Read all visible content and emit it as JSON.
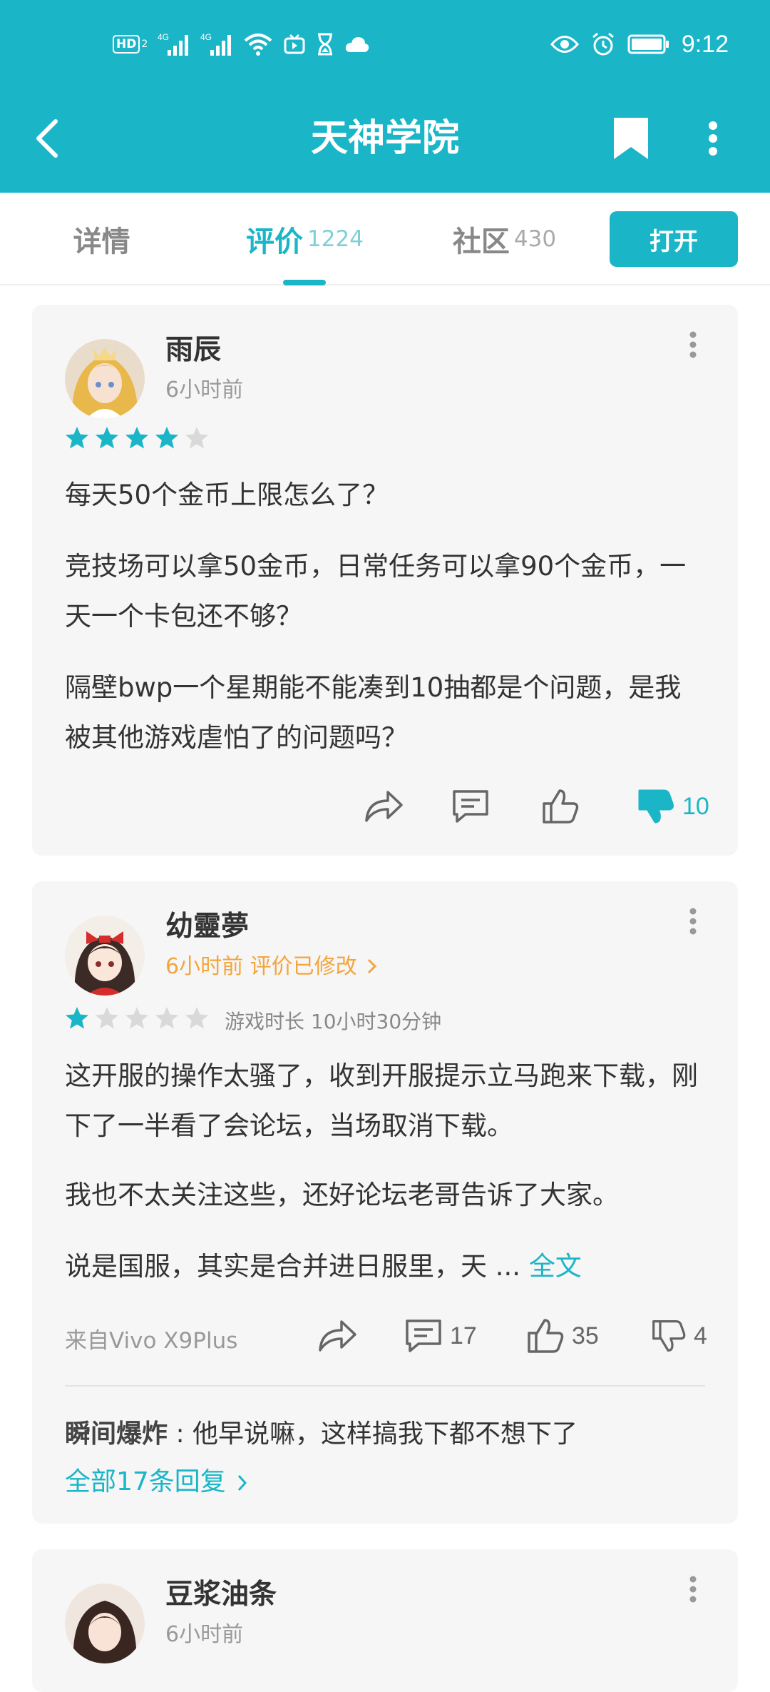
{
  "status_bar": {
    "time": "9:12",
    "hd_label": "HD",
    "sim_label": "2",
    "signal1_label": "4G",
    "signal2_label": "4G"
  },
  "app_bar": {
    "title": "天神学院"
  },
  "tabs": [
    {
      "label": "详情",
      "count": ""
    },
    {
      "label": "评价",
      "count": "1224"
    },
    {
      "label": "社区",
      "count": "430"
    }
  ],
  "open_button": "打开",
  "colors": {
    "brand": "#1ab6c8",
    "edited": "#f3a53c",
    "star_on": "#1ab6c8",
    "star_off": "#d9d9d9"
  },
  "reviews": [
    {
      "user": "雨辰",
      "time": "6小时前",
      "rating": 4,
      "paragraphs": [
        "每天50个金币上限怎么了？",
        "竞技场可以拿50金币，日常任务可以拿90个金币，一天一个卡包还不够？",
        "隔壁bwp一个星期能不能凑到10抽都是个问题，是我被其他游戏虐怕了的问题吗？"
      ],
      "dislike_count": "10"
    },
    {
      "user": "幼靈夢",
      "time": "6小时前 评价已修改",
      "rating": 1,
      "playtime": "游戏时长 10小时30分钟",
      "paragraphs": [
        "这开服的操作太骚了，收到开服提示立马跑来下载，刚下了一半看了会论坛，当场取消下载。",
        "我也不太关注这些，还好论坛老哥告诉了大家。",
        "说是国服，其实是合并进日服里，天 ..."
      ],
      "read_more": "全文",
      "device": "来自Vivo X9Plus",
      "comment_count": "17",
      "like_count": "35",
      "dislike_count": "4",
      "reply_user": "瞬间爆炸",
      "reply_text": " : 他早说嘛，这样搞我下都不想下了",
      "all_replies": "全部17条回复"
    },
    {
      "user": "豆浆油条",
      "time": "6小时前"
    }
  ]
}
